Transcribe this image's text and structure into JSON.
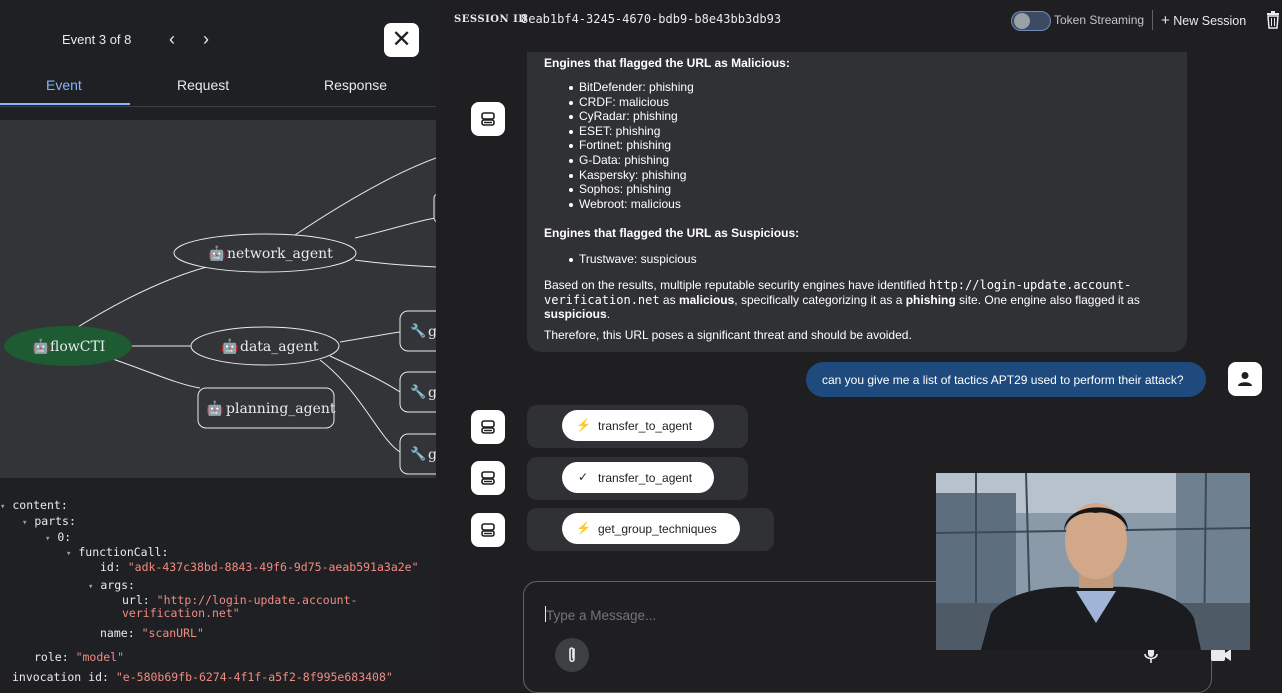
{
  "event_panel": {
    "counter": "Event 3 of 8",
    "prev_icon": "chevron-left-icon",
    "next_icon": "chevron-right-icon",
    "close_icon": "close-icon",
    "tabs": [
      {
        "label": "Event",
        "active": true
      },
      {
        "label": "Request",
        "active": false
      },
      {
        "label": "Response",
        "active": false
      }
    ]
  },
  "agent_graph": {
    "nodes": [
      {
        "id": "flowCTI",
        "label": "flowCTI",
        "icon": "robot-icon",
        "highlighted": true
      },
      {
        "id": "network_agent",
        "label": "network_agent",
        "icon": "robot-icon"
      },
      {
        "id": "data_agent",
        "label": "data_agent",
        "icon": "robot-icon"
      },
      {
        "id": "planning_agent",
        "label": "planning_agent",
        "icon": "robot-icon"
      },
      {
        "id": "tool_g1",
        "label": "g",
        "icon": "wrench-icon"
      },
      {
        "id": "tool_g2",
        "label": "g",
        "icon": "wrench-icon"
      },
      {
        "id": "tool_g3",
        "label": "g",
        "icon": "wrench-icon"
      }
    ],
    "colors": {
      "background": "#323437",
      "highlight": "#1e5b32",
      "edge": "#e8eaed"
    }
  },
  "event_json": {
    "content_key": "content:",
    "parts_key": "parts:",
    "index_key": "0:",
    "function_call_key": "functionCall:",
    "id_key": "id:",
    "id_value": "\"adk-437c38bd-8843-49f6-9d75-aeab591a3a2e\"",
    "args_key": "args:",
    "url_key": "url:",
    "url_value_line1": "\"http://login-update.account-",
    "url_value_line2": "verification.net\"",
    "name_key": "name:",
    "name_value": "\"scanURL\"",
    "role_key": "role:",
    "role_value": "\"model\"",
    "invocation_key": "invocation_id:",
    "invocation_value": "\"e-580b69fb-6274-4f1f-a5f2-8f995e683408\""
  },
  "session": {
    "label": "SESSION ID",
    "id": "8eab1bf4-3245-4670-bdb9-b8e43bb3db93",
    "token_streaming_label": "Token Streaming",
    "token_streaming_enabled": false,
    "new_session_label": "New Session",
    "delete_icon": "trash-icon"
  },
  "chat": {
    "bot_message": {
      "malicious_heading": "Engines that flagged the URL as Malicious:",
      "malicious_engines": [
        "BitDefender: phishing",
        "CRDF: malicious",
        "CyRadar: phishing",
        "ESET: phishing",
        "Fortinet: phishing",
        "G-Data: phishing",
        "Kaspersky: phishing",
        "Sophos: phishing",
        "Webroot: malicious"
      ],
      "suspicious_heading": "Engines that flagged the URL as Suspicious:",
      "suspicious_engines": [
        "Trustwave: suspicious"
      ],
      "summary_part1": "Based on the results, multiple reputable security engines have identified ",
      "summary_url1": "http://login-update.account-",
      "summary_url2": "verification.net",
      "summary_part2": " as ",
      "summary_malicious": "malicious",
      "summary_part3": ", specifically categorizing it as a ",
      "summary_phishing": "phishing",
      "summary_part4": " site. One engine also flagged it as",
      "summary_suspicious": "suspicious",
      "summary_part5": ".",
      "conclusion": "Therefore, this URL poses a significant threat and should be avoided."
    },
    "user_message": "can you give me a list of tactics APT29 used to perform their attack?",
    "function_events": [
      {
        "label": "transfer_to_agent",
        "icon": "bolt-icon",
        "glyph": "⚡"
      },
      {
        "label": "transfer_to_agent",
        "icon": "check-icon",
        "glyph": "✓"
      },
      {
        "label": "get_group_techniques",
        "icon": "bolt-icon",
        "glyph": "⚡"
      }
    ]
  },
  "composer": {
    "placeholder": "Type a Message...",
    "value": "",
    "attach_icon": "paperclip-icon",
    "mic_icon": "microphone-icon",
    "video_icon": "video-camera-icon"
  }
}
